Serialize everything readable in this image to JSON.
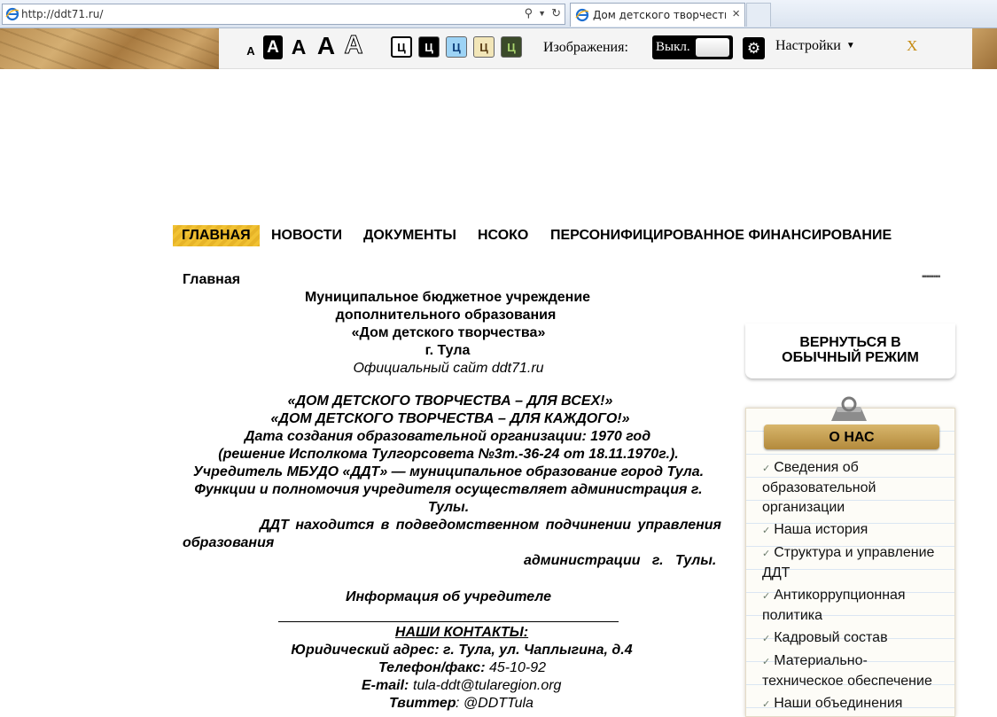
{
  "browser": {
    "url": "http://ddt71.ru/",
    "tab_title": "Дом детского творчества ...",
    "tab_close": "×"
  },
  "accessibility": {
    "font_sizes": [
      "A",
      "A",
      "A",
      "A",
      "A"
    ],
    "color_letters": [
      "Ц",
      "Ц",
      "Ц",
      "Ц",
      "Ц"
    ],
    "images_label": "Изображения:",
    "images_toggle": "Выкл.",
    "settings_label": "Настройки",
    "close_label": "X"
  },
  "nav": {
    "items": [
      "ГЛАВНАЯ",
      "НОВОСТИ",
      "ДОКУМЕНТЫ",
      "НСОКО",
      "ПЕРСОНИФИЦИРОВАННОЕ ФИНАНСИРОВАНИЕ"
    ]
  },
  "main": {
    "breadcrumb": "Главная",
    "org_lines": [
      "Муниципальное бюджетное учреждение",
      "дополнительного образования",
      "«Дом детского творчества»",
      "г. Тула"
    ],
    "official_site": "Официальный сайт ddt71.ru",
    "slogan_1": "«ДОМ ДЕТСКОГО ТВОРЧЕСТВА – ДЛЯ ВСЕХ!»",
    "slogan_2": "«ДОМ ДЕТСКОГО ТВОРЧЕСТВА – ДЛЯ КАЖДОГО!»",
    "founded": "Дата создания образовательной организации: 1970 год",
    "decision": "(решение Исполкома Тулгорсовета №3т.-36-24 от 18.11.1970г.).",
    "founder": "Учредитель МБУДО «ДДТ» — муниципальное образование город Тула.",
    "functions_1": "Функции и полномочия учредителя осуществляет администрация г.",
    "functions_2": "Тулы.",
    "subordinate_1": "ДДТ находится в подведомственном подчинении управления",
    "subordinate_2": "образования",
    "subordinate_3": "администрации   г.   Тулы.",
    "founder_info": "Информация об учредителе",
    "contacts_title": "НАШИ КОНТАКТЫ:",
    "address": "Юридический адрес: г. Тула, ул. Чаплыгина, д.4",
    "phone_label": "Телефон/факс:",
    "phone": "45-10-92",
    "email_label": "E-mail:",
    "email": "tula-ddt@tularegion.org",
    "twitter_label": "Твиттер",
    "twitter": ": @DDTTula"
  },
  "sidebar": {
    "return_line_1": "ВЕРНУТЬСЯ В",
    "return_line_2": "ОБЫЧНЫЙ РЕЖИМ",
    "about_title": "О НАС",
    "menu": [
      "Сведения об образовательной организации",
      "Наша история",
      "Структура и управление ДДТ",
      "Антикоррупционная политика",
      "Кадровый состав",
      "Материально-техническое обеспечение",
      "Наши объединения"
    ]
  }
}
